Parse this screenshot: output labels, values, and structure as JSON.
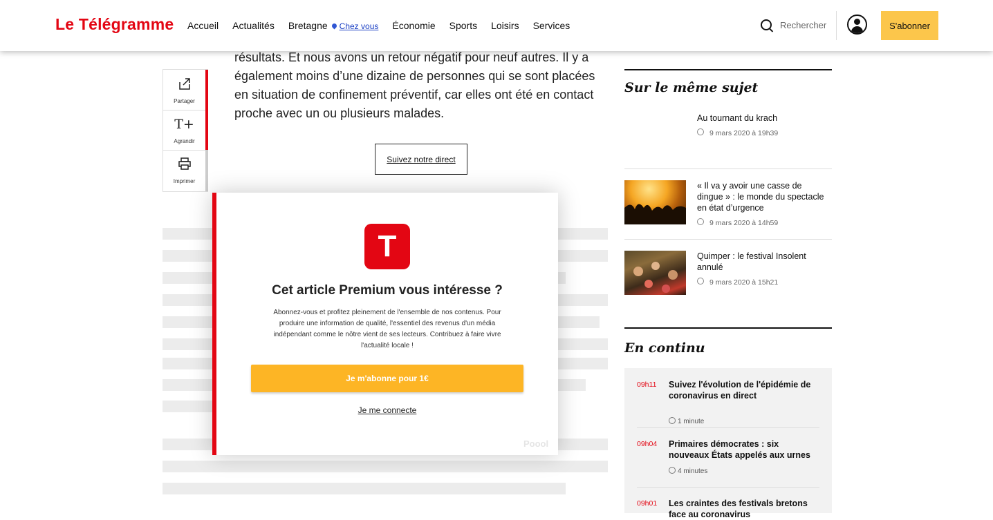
{
  "header": {
    "logo": "Le Télégramme",
    "nav": {
      "accueil": "Accueil",
      "actualites": "Actualités",
      "bretagne": "Bretagne",
      "chez_vous": "Chez vous",
      "economie": "Économie",
      "sports": "Sports",
      "loisirs": "Loisirs",
      "services": "Services"
    },
    "search_label": "Rechercher",
    "subscribe_label": "S'abonner",
    "accent_color": "#e30613",
    "subscribe_color": "#fcc64b"
  },
  "article": {
    "text": "résultats. Et nous avons un retour négatif pour neuf autres. Il y a également moins d’une dizaine de personnes qui se sont placées en situation de confinement préventif, car elles ont été en contact proche avec un ou plusieurs malades.",
    "direct_button": "Suivez notre direct"
  },
  "share": {
    "partager": "Partager",
    "agrandir": "Agrandir",
    "imprimer": "Imprimer",
    "agrandir_icon_text": "T+"
  },
  "modal": {
    "logo_letter": "T",
    "title": "Cet article Premium vous intéresse ?",
    "description": "Abonnez-vous et profitez pleinement de l'ensemble de nos contenus. Pour produire une information de qualité, l'essentiel des revenus d'un média indépendant comme le nôtre vient de ses lecteurs. Contribuez à faire vivre l'actualité locale !",
    "cta": "Je m'abonne pour 1€",
    "login": "Je me connecte",
    "brand": "Poool"
  },
  "related": {
    "title": "Sur le même sujet",
    "items": [
      {
        "title": "Au tournant du krach",
        "date": "9 mars 2020 à 19h39"
      },
      {
        "title": "« Il va y avoir une casse de dingue » : le monde du spectacle en état d’urgence",
        "date": "9 mars 2020 à 14h59"
      },
      {
        "title": "Quimper : le festival Insolent annulé",
        "date": "9 mars 2020 à 15h21"
      }
    ]
  },
  "continu": {
    "title": "En continu",
    "items": [
      {
        "time": "09h11",
        "title": "Suivez l'évolution de l'épidémie de coronavirus en direct",
        "duration": "1 minute"
      },
      {
        "time": "09h04",
        "title": "Primaires démocrates : six nouveaux États appelés aux urnes",
        "duration": "4 minutes"
      },
      {
        "time": "09h01",
        "title": "Les craintes des festivals bretons face au coronavirus",
        "duration": ""
      }
    ]
  }
}
